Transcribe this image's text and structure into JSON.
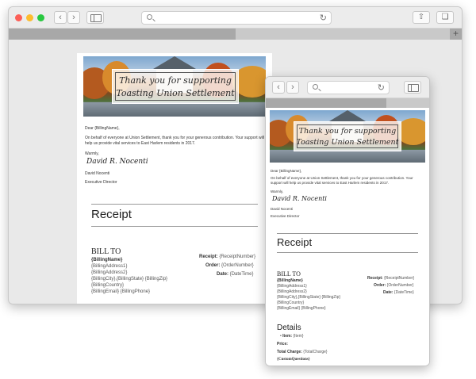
{
  "banner": {
    "line1": "Thank you for supporting",
    "line2": "Toasting Union Settlement"
  },
  "letter": {
    "salutation": "Dear {BillingName},",
    "body": "On behalf of everyone at Union Settlement, thank you for your generous contribution. Your support will help us provide vital services to East Harlem residents in 2017.",
    "closing": "Warmly,",
    "signature": "David R. Nocenti",
    "name": "David Nocenti",
    "title": "Executive Director"
  },
  "receipt": {
    "heading": "Receipt",
    "bill_to": "BILL TO",
    "billing_name": "{BillingName}",
    "address1": "{BillingAddress1}",
    "address2": "{BillingAddress2}",
    "city_state_zip": "{BillingCity},{BillingState} {BillingZip}",
    "city_state_zip_mobile": "{BillingCity},{BillingState} {BillingZip}",
    "country": "{BillingCountry}",
    "email_phone": "{BillingEmail} {BillingPhone}",
    "receipt_label": "Receipt:",
    "receipt_value": "{ReceiptNumber}",
    "order_label": "Order:",
    "order_value": "{OrderNumber}",
    "date_label": "Date:",
    "date_value": "{DateTime}"
  },
  "details": {
    "heading": "Details",
    "item_label": "Item:",
    "item_value": "{Item}",
    "price_label": "Price:",
    "total_label": "Total Charge:",
    "total_value": "{TotalCharge}",
    "custom": "{CustomQuestions}"
  },
  "colors": {
    "close": "#fc5f57",
    "minimize": "#fdbc2e",
    "maximize": "#28c840"
  },
  "icons": [
    "back-icon",
    "forward-icon",
    "sidebar-icon",
    "search-icon",
    "reload-icon",
    "share-icon",
    "tabs-icon",
    "plus-icon"
  ]
}
